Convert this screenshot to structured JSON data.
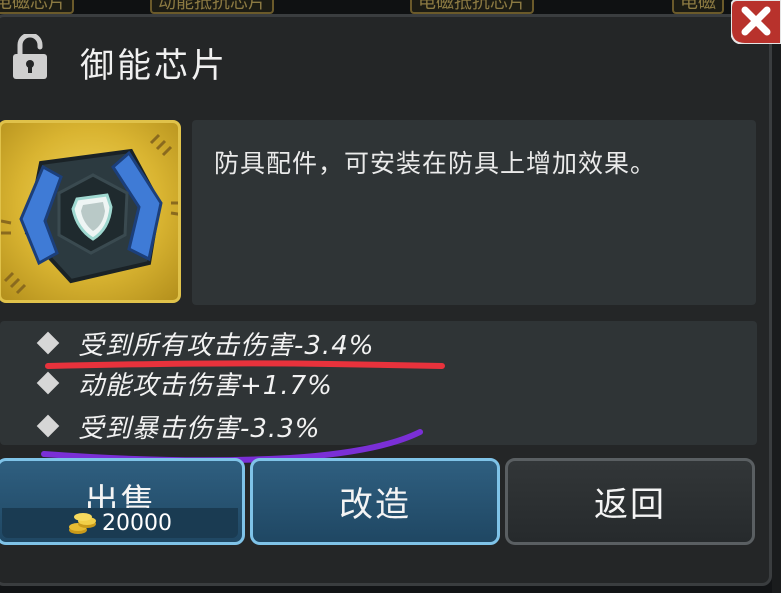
{
  "background_tabs": [
    "电磁芯片",
    "动能抵抗芯片",
    "电磁抵抗芯片",
    "电磁"
  ],
  "header": {
    "lock_icon": "unlocked-padlock-icon",
    "title": "御能芯片",
    "close_icon": "close-x-icon"
  },
  "item": {
    "icon": "shield-chip-icon",
    "description": "防具配件，可安装在防具上增加效果。"
  },
  "stats": [
    "受到所有攻击伤害-3.4%",
    "动能攻击伤害+1.7%",
    "受到暴击伤害-3.3%"
  ],
  "buttons": {
    "sell": {
      "label": "出售",
      "price": "20000",
      "currency_icon": "gold-coin-stack-icon"
    },
    "modify": {
      "label": "改造"
    },
    "back": {
      "label": "返回"
    }
  },
  "colors": {
    "panel": "#242627",
    "box": "#2f3436",
    "gold_frame": "#e0c24a",
    "blue_button_border": "#7fc3e8",
    "annotation_red": "#e8323c",
    "annotation_purple": "#7a2fd6"
  }
}
